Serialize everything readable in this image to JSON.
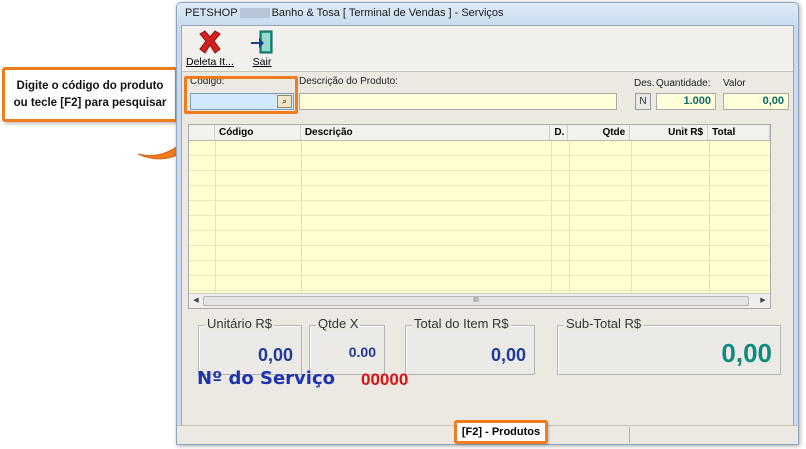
{
  "callout": {
    "text_line1": "Digite o código do produto",
    "text_line2": "ou tecle [F2] para pesquisar"
  },
  "window": {
    "title_left": "PETSHOP",
    "title_right": "Banho & Tosa [ Terminal de Vendas ] - Serviços"
  },
  "toolbar": {
    "delete_label": "Deleta It...",
    "exit_label": "Sair"
  },
  "form": {
    "codigo_label": "Código:",
    "codigo_value": "",
    "descricao_label": "Descrição do  Produto:",
    "descricao_value": "",
    "des_label": "Des.",
    "des_value": "N",
    "quantidade_label": "Quantidade:",
    "quantidade_value": "1.000",
    "valor_label": "Valor",
    "valor_value": "0,00"
  },
  "grid": {
    "columns": [
      "Código",
      "Descrição",
      "D.",
      "Qtde",
      "Unit R$",
      "Total"
    ],
    "rows": [],
    "scroll_grip": "III"
  },
  "totals": {
    "unitario_label": "Unitário R$",
    "unitario_value": "0,00",
    "qtde_label": "Qtde X",
    "qtde_value": "0.00",
    "total_item_label": "Total do Item R$",
    "total_item_value": "0,00",
    "subtotal_label": "Sub-Total R$",
    "subtotal_value": "0,00"
  },
  "servico": {
    "label": "Nº do Serviço",
    "number": "00000"
  },
  "status": {
    "f2_hint": "[F2] - Produtos"
  },
  "colors": {
    "accent_orange": "#f07c1e",
    "subtotal_teal": "#0f8a7e",
    "servico_blue": "#1d33b0",
    "servico_red": "#e01010"
  }
}
